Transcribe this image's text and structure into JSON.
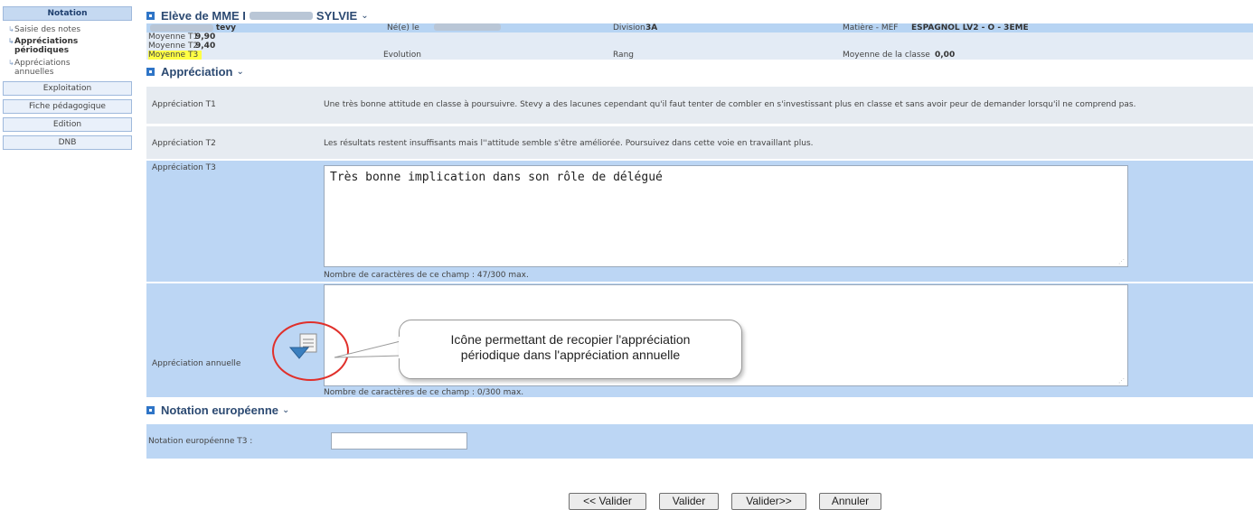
{
  "sidebar": {
    "notation": "Notation",
    "saisie": "Saisie des notes",
    "appr_periodiques": "Appréciations périodiques",
    "appr_annuelles": "Appréciations annuelles",
    "exploitation": "Exploitation",
    "fiche": "Fiche pédagogique",
    "edition": "Edition",
    "dnb": "DNB"
  },
  "student_header": {
    "title_prefix": "Elève de MME I",
    "title_suffix": "SYLVIE",
    "chevron": "⌄"
  },
  "student": {
    "name": "tevy",
    "birth_label": "Né(e) le",
    "division_label": "Division",
    "division": "3A",
    "matiere_label": "Matière - MEF",
    "matiere": "ESPAGNOL LV2 - O - 3EME",
    "moy_t1_label": "Moyenne T1",
    "moy_t1": "9,90",
    "moy_t2_label": "Moyenne T2",
    "moy_t2": "9,40",
    "moy_t3_label": "Moyenne T3",
    "evolution_label": "Evolution",
    "rang_label": "Rang",
    "moy_classe_label": "Moyenne de la classe",
    "moy_classe": "0,00"
  },
  "appreciation": {
    "section_title": "Appréciation",
    "t1_label": "Appréciation T1",
    "t1_text": "Une très bonne attitude en classe à poursuivre. Stevy a des lacunes cependant qu'il faut tenter de combler en s'investissant plus en classe et sans avoir peur de demander lorsqu'il ne comprend pas.",
    "t2_label": "Appréciation T2",
    "t2_text": "Les résultats restent insuffisants mais l''attitude semble s'être améliorée. Poursuivez dans cette voie en travaillant plus.",
    "t3_label": "Appréciation T3",
    "t3_value": "Très bonne implication dans son rôle de délégué",
    "t3_counter": "Nombre de caractères de ce champ : 47/300 max.",
    "annuelle_label": "Appréciation annuelle",
    "annuelle_value": "",
    "annuelle_counter": "Nombre de caractères de ce champ : 0/300 max."
  },
  "euro": {
    "section_title": "Notation européenne",
    "t3_label": "Notation européenne T3 :",
    "t3_value": ""
  },
  "buttons": {
    "prev": "<< Valider",
    "valider": "Valider",
    "next": "Valider>>",
    "annuler": "Annuler"
  },
  "annotation": {
    "callout_line1": "Icône permettant  de recopier l'appréciation",
    "callout_line2": "périodique dans l'appréciation annuelle"
  },
  "colors": {
    "accent": "#2f75c7",
    "row_blue": "#bcd6f4",
    "annotation_red": "#e0302b"
  }
}
